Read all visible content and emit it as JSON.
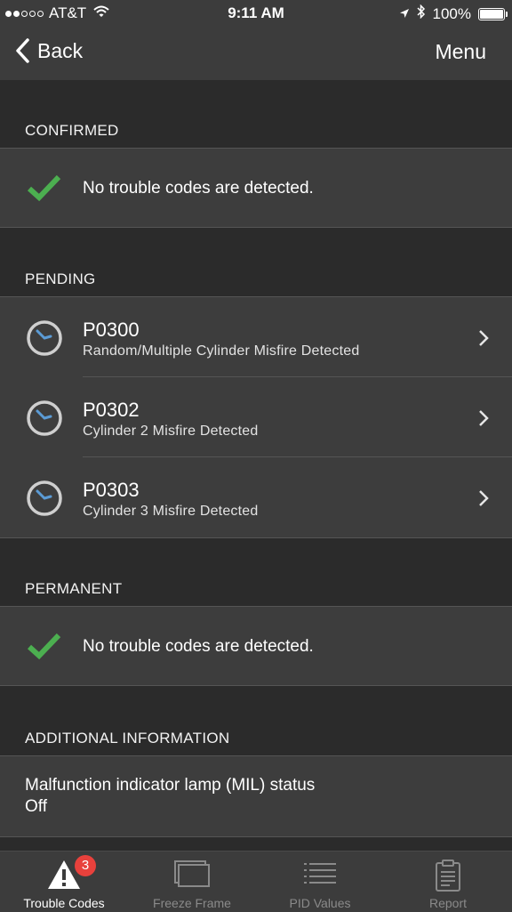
{
  "status_bar": {
    "carrier": "AT&T",
    "time": "9:11 AM",
    "battery": "100%",
    "signal_bars": 2
  },
  "nav": {
    "back_label": "Back",
    "menu_label": "Menu"
  },
  "sections": {
    "confirmed": {
      "header": "CONFIRMED",
      "message": "No trouble codes are detected."
    },
    "pending": {
      "header": "PENDING",
      "items": [
        {
          "code": "P0300",
          "description": "Random/Multiple Cylinder Misfire Detected"
        },
        {
          "code": "P0302",
          "description": "Cylinder 2 Misfire Detected"
        },
        {
          "code": "P0303",
          "description": "Cylinder 3 Misfire Detected"
        }
      ]
    },
    "permanent": {
      "header": "PERMANENT",
      "message": "No trouble codes are detected."
    },
    "additional": {
      "header": "ADDITIONAL INFORMATION",
      "mil_label": "Malfunction indicator lamp (MIL) status",
      "mil_value": "Off"
    }
  },
  "tabs": [
    {
      "label": "Trouble Codes",
      "icon": "warning-icon",
      "badge": "3",
      "active": true
    },
    {
      "label": "Freeze Frame",
      "icon": "freeze-frame-icon",
      "active": false
    },
    {
      "label": "PID Values",
      "icon": "list-icon",
      "active": false
    },
    {
      "label": "Report",
      "icon": "clipboard-icon",
      "active": false
    }
  ],
  "colors": {
    "background": "#2b2b2b",
    "cell": "#3d3d3d",
    "check": "#4caf50",
    "clock_hands": "#5b9bd5",
    "badge": "#e8413c"
  }
}
